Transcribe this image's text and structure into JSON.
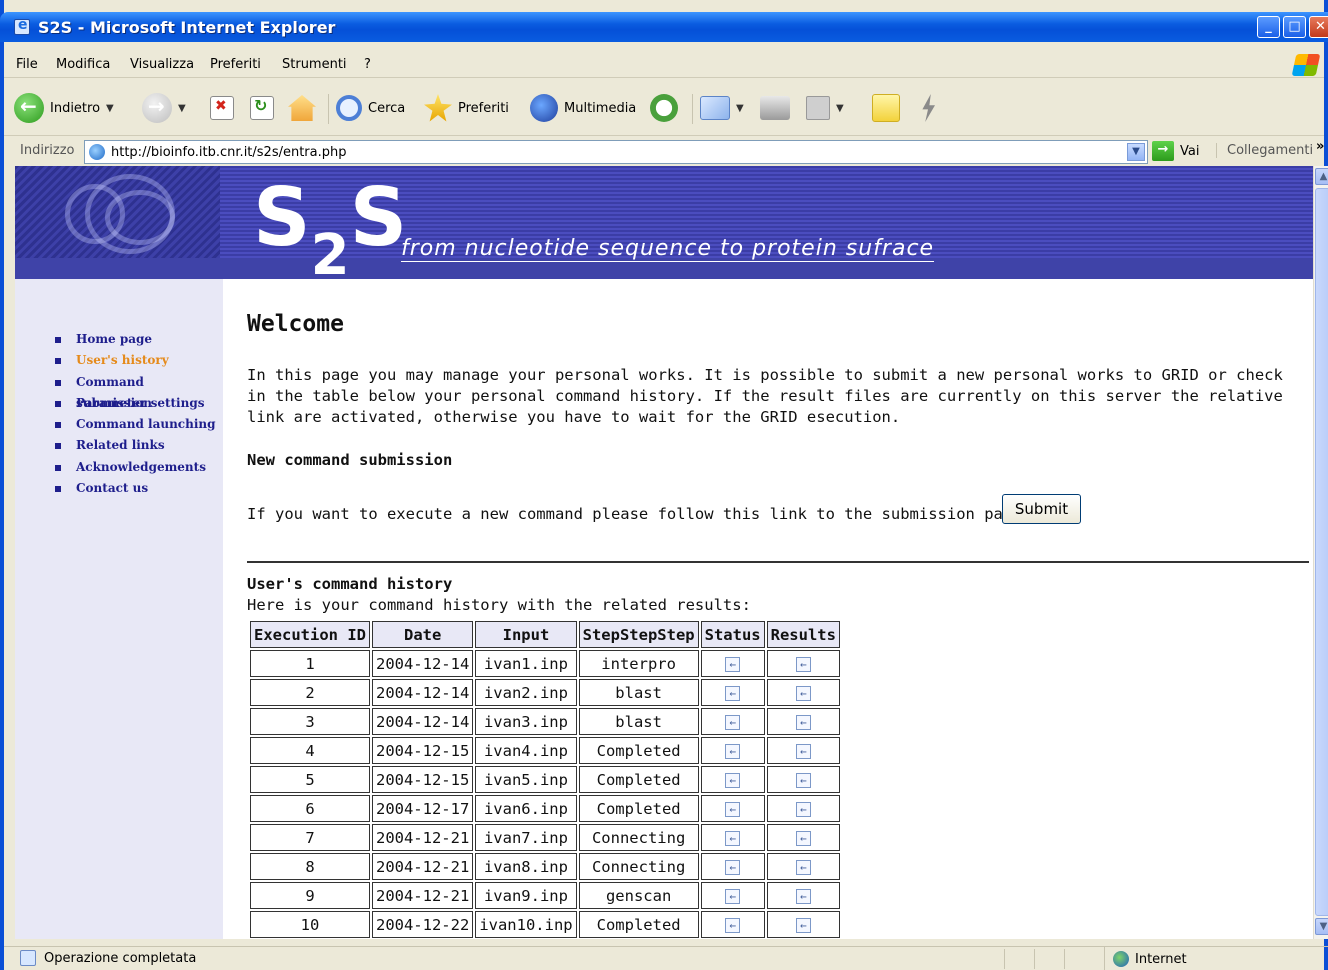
{
  "window": {
    "title": "S2S - Microsoft Internet Explorer"
  },
  "menu": [
    "File",
    "Modifica",
    "Visualizza",
    "Preferiti",
    "Strumenti",
    "?"
  ],
  "toolbar": {
    "back_label": "Indietro",
    "search_label": "Cerca",
    "favorites_label": "Preferiti",
    "media_label": "Multimedia"
  },
  "address": {
    "label": "Indirizzo",
    "url": "http://bioinfo.itb.cnr.it/s2s/entra.php",
    "go_label": "Vai",
    "links_label": "Collegamenti",
    "more": "»"
  },
  "banner": {
    "brand_main": "S",
    "brand_sub": "2",
    "brand_end": "S",
    "tagline": "from nucleotide sequence to protein sufrace"
  },
  "nav": [
    {
      "label": "Home page",
      "active": false
    },
    {
      "label": "User's history",
      "active": true
    },
    {
      "label": "Command submission",
      "active": false
    },
    {
      "label": "Parameter settings",
      "active": false
    },
    {
      "label": "Command launching",
      "active": false
    },
    {
      "label": "Related links",
      "active": false
    },
    {
      "label": "Acknowledgements",
      "active": false
    },
    {
      "label": "Contact us",
      "active": false
    }
  ],
  "main": {
    "title": "Welcome",
    "intro": "In this page you may manage your personal works. It is possible to submit a new personal works to GRID or check in the table below your personal command history. If the result files are currently on this server the relative link are activated, otherwise you have to wait for the GRID esecution.",
    "new_cmd_heading": "New command submission",
    "submit_text": "If you want to execute a new command please follow this link to the submission pages:",
    "submit_button": "Submit",
    "history_heading": "User's command history",
    "history_sub": "Here is your command history with the related results:"
  },
  "table": {
    "headers": [
      "Execution ID",
      "Date",
      "Input",
      "StepStepStep",
      "Status",
      "Results"
    ],
    "rows": [
      [
        "1",
        "2004-12-14",
        "ivan1.inp",
        "interpro"
      ],
      [
        "2",
        "2004-12-14",
        "ivan2.inp",
        "blast"
      ],
      [
        "3",
        "2004-12-14",
        "ivan3.inp",
        "blast"
      ],
      [
        "4",
        "2004-12-15",
        "ivan4.inp",
        "Completed"
      ],
      [
        "5",
        "2004-12-15",
        "ivan5.inp",
        "Completed"
      ],
      [
        "6",
        "2004-12-17",
        "ivan6.inp",
        "Completed"
      ],
      [
        "7",
        "2004-12-21",
        "ivan7.inp",
        "Connecting"
      ],
      [
        "8",
        "2004-12-21",
        "ivan8.inp",
        "Connecting"
      ],
      [
        "9",
        "2004-12-21",
        "ivan9.inp",
        "genscan"
      ],
      [
        "10",
        "2004-12-22",
        "ivan10.inp",
        "Completed"
      ]
    ]
  },
  "status": {
    "text": "Operazione completata",
    "zone": "Internet"
  },
  "colors": {
    "titlebar": "#0a5ce0",
    "banner": "#3f43a8",
    "nav_link": "#1e1e8c",
    "nav_active": "#e58a1a"
  }
}
